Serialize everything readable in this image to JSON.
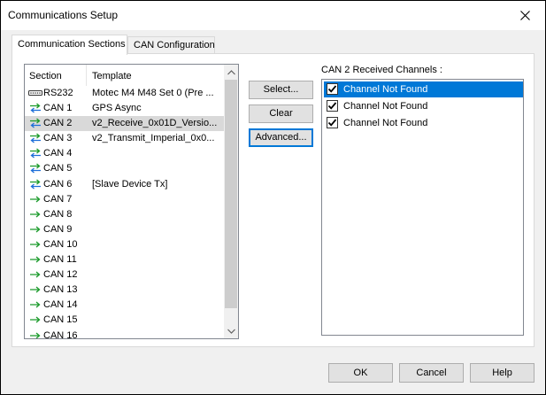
{
  "window": {
    "title": "Communications Setup"
  },
  "tabs": [
    {
      "label": "Communication Sections",
      "active": true
    },
    {
      "label": "CAN Configuration",
      "active": false
    }
  ],
  "sections_list": {
    "columns": [
      "Section",
      "Template"
    ],
    "rows": [
      {
        "section": "RS232",
        "template": "Motec M4 M48 Set 0 (Pre ...",
        "icon": "serial-port-icon"
      },
      {
        "section": "CAN 1",
        "template": "GPS Async",
        "icon": "bidirectional-arrow-icon"
      },
      {
        "section": "CAN 2",
        "template": "v2_Receive_0x01D_Versio...",
        "icon": "bidirectional-arrow-icon",
        "selected": true
      },
      {
        "section": "CAN 3",
        "template": "v2_Transmit_Imperial_0x0...",
        "icon": "bidirectional-arrow-icon"
      },
      {
        "section": "CAN 4",
        "template": "",
        "icon": "bidirectional-arrow-icon"
      },
      {
        "section": "CAN 5",
        "template": "",
        "icon": "bidirectional-arrow-icon"
      },
      {
        "section": "CAN 6",
        "template": "[Slave Device Tx]",
        "icon": "bidirectional-arrow-icon"
      },
      {
        "section": "CAN 7",
        "template": "",
        "icon": "right-arrow-icon"
      },
      {
        "section": "CAN 8",
        "template": "",
        "icon": "right-arrow-icon"
      },
      {
        "section": "CAN 9",
        "template": "",
        "icon": "right-arrow-icon"
      },
      {
        "section": "CAN 10",
        "template": "",
        "icon": "right-arrow-icon"
      },
      {
        "section": "CAN 11",
        "template": "",
        "icon": "right-arrow-icon"
      },
      {
        "section": "CAN 12",
        "template": "",
        "icon": "right-arrow-icon"
      },
      {
        "section": "CAN 13",
        "template": "",
        "icon": "right-arrow-icon"
      },
      {
        "section": "CAN 14",
        "template": "",
        "icon": "right-arrow-icon"
      },
      {
        "section": "CAN 15",
        "template": "",
        "icon": "right-arrow-icon"
      },
      {
        "section": "CAN 16",
        "template": "",
        "icon": "right-arrow-icon"
      }
    ]
  },
  "action_buttons": {
    "select": "Select...",
    "clear": "Clear",
    "advanced": "Advanced..."
  },
  "received_channels": {
    "label": "CAN 2 Received Channels :",
    "items": [
      {
        "label": "Channel Not Found",
        "checked": true,
        "selected": true
      },
      {
        "label": "Channel Not Found",
        "checked": true,
        "selected": false
      },
      {
        "label": "Channel Not Found",
        "checked": true,
        "selected": false
      }
    ]
  },
  "footer": {
    "ok": "OK",
    "cancel": "Cancel",
    "help": "Help"
  },
  "colors": {
    "selection_blue": "#0078d7",
    "bidirectional_arrow": "#1e6fd9",
    "right_arrow": "#1a9a2a",
    "row_selected": "#d9d9d9"
  }
}
